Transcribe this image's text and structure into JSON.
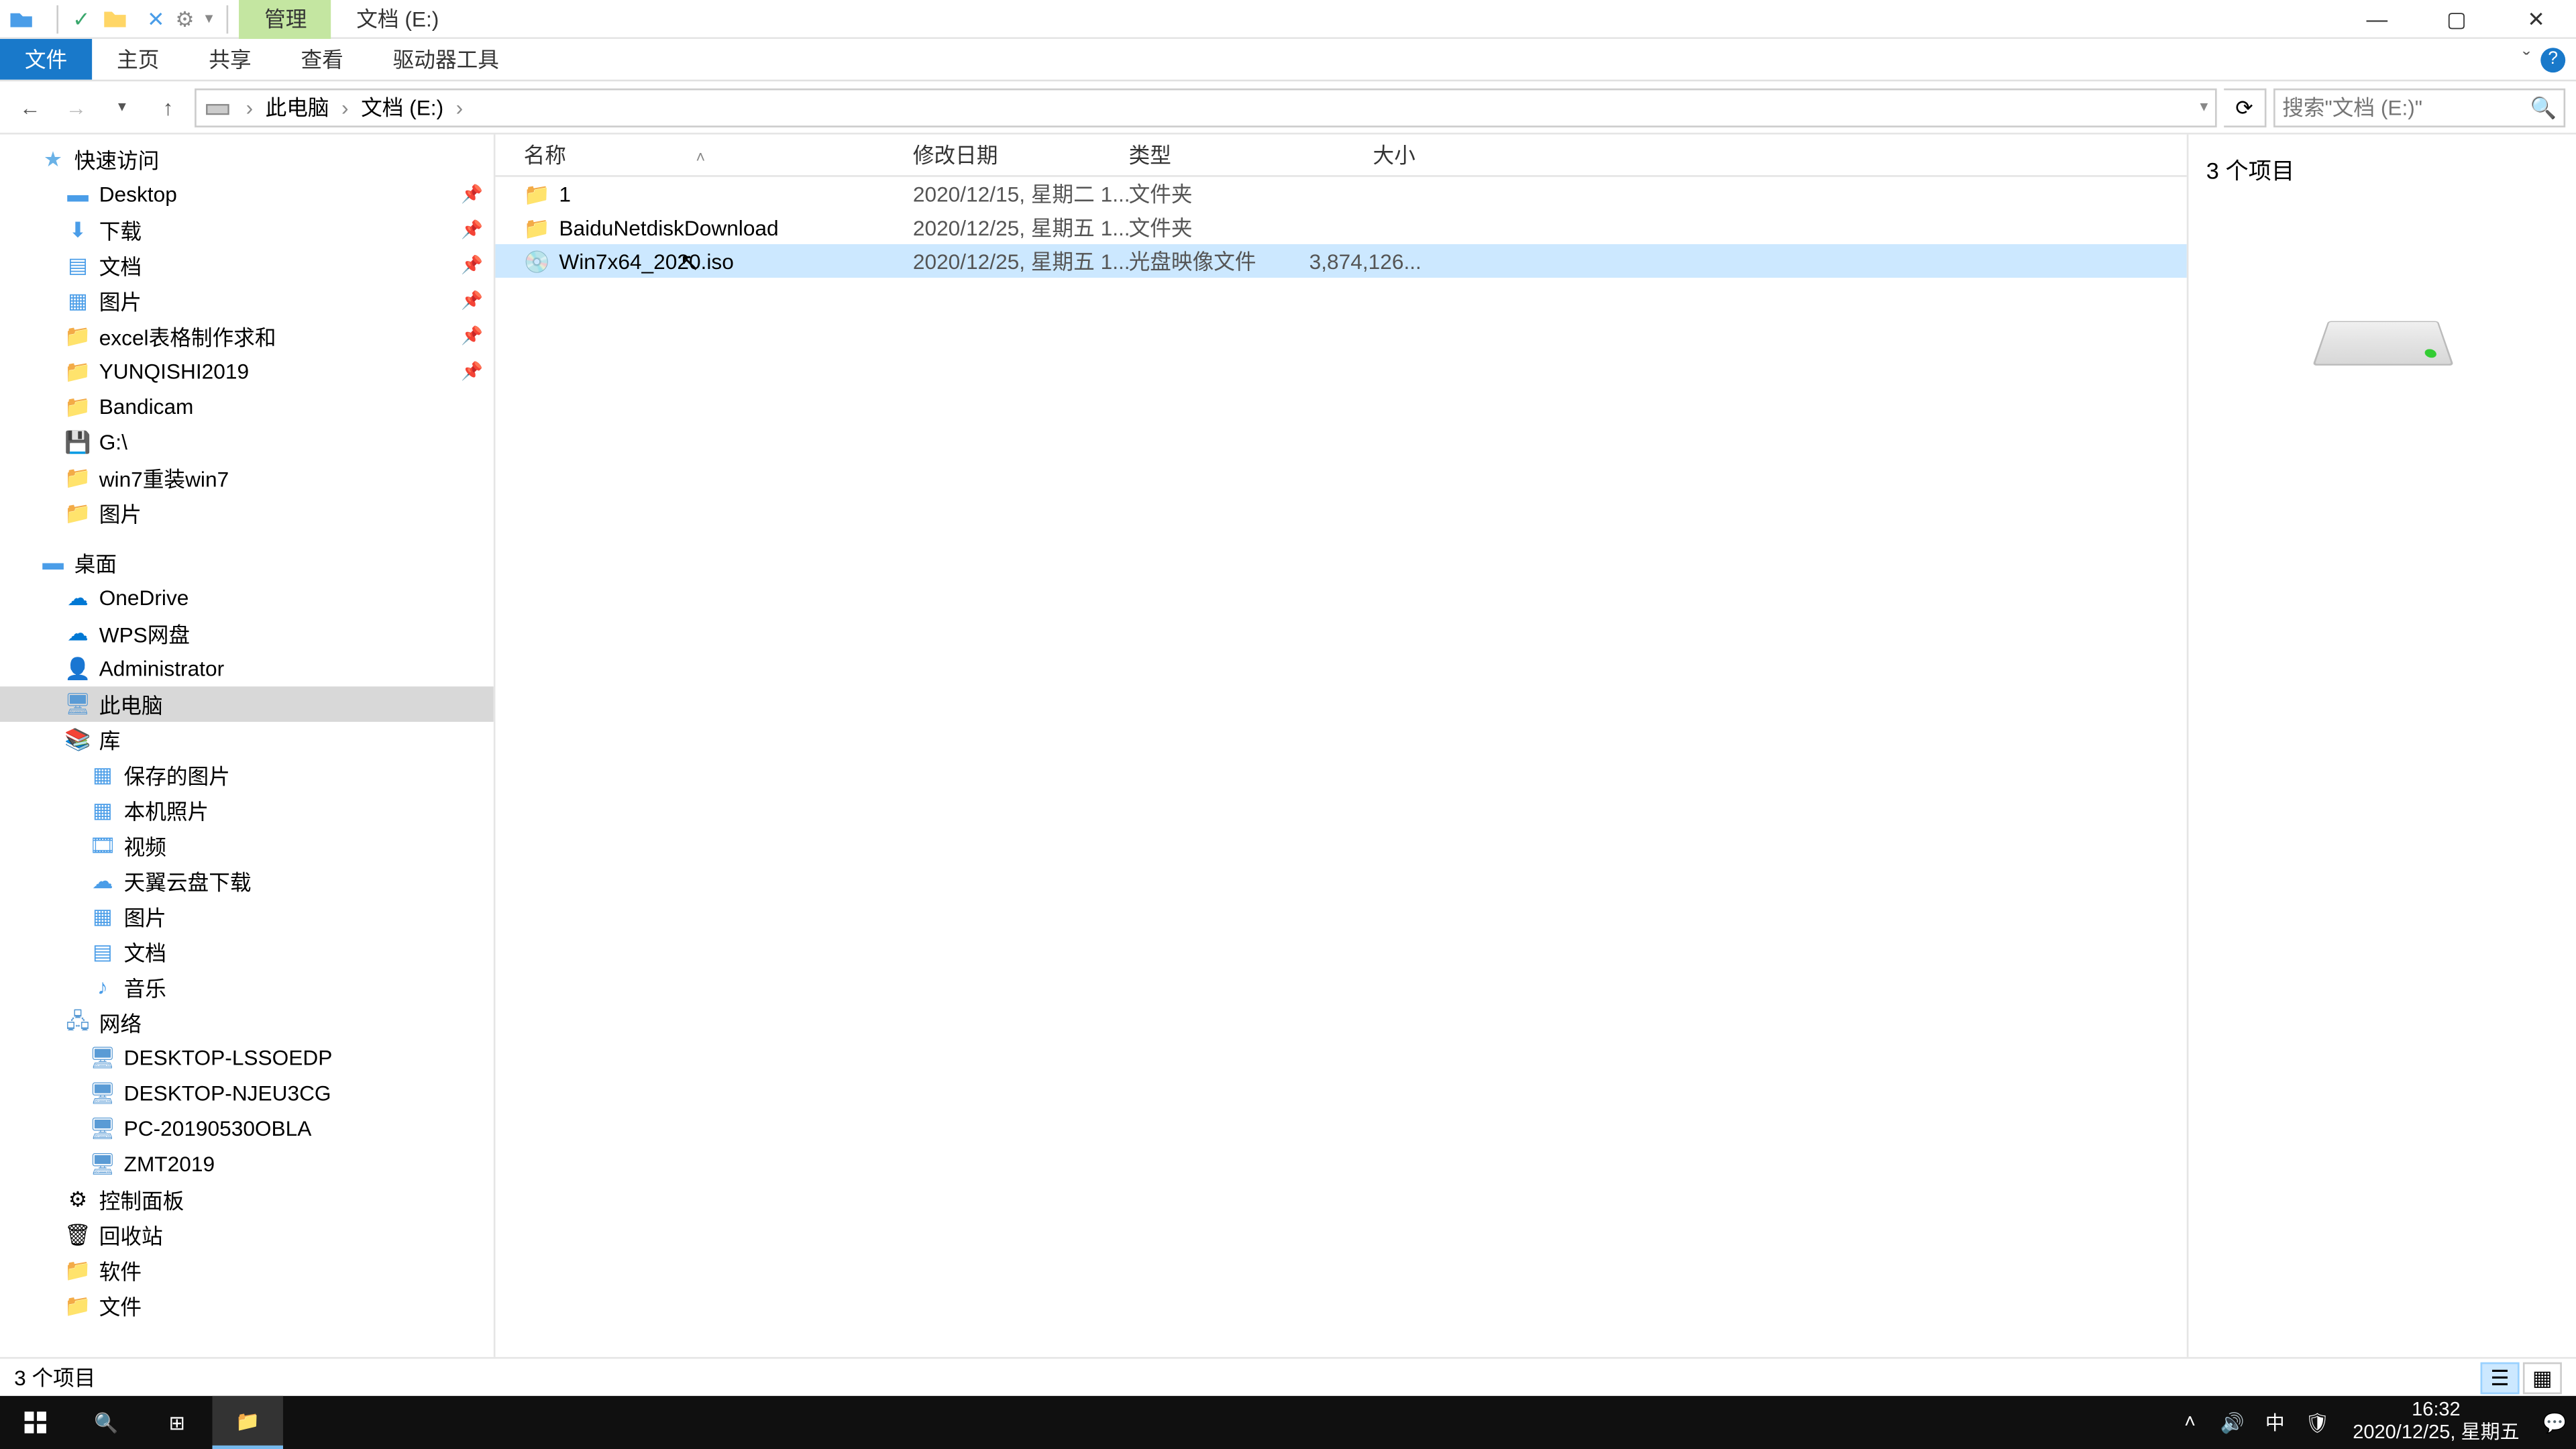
{
  "titlebar": {
    "contextual_tab": "管理",
    "location_tab": "文档 (E:)"
  },
  "ribbon": {
    "file": "文件",
    "home": "主页",
    "share": "共享",
    "view": "查看",
    "drive_tools": "驱动器工具"
  },
  "breadcrumb": {
    "root": "此电脑",
    "drive": "文档 (E:)"
  },
  "search": {
    "placeholder": "搜索\"文档 (E:)\""
  },
  "nav": {
    "quick_access": "快速访问",
    "desktop": "Desktop",
    "downloads": "下载",
    "documents": "文档",
    "pictures": "图片",
    "excel": "excel表格制作求和",
    "yunqishi": "YUNQISHI2019",
    "bandicam": "Bandicam",
    "gdrive": "G:\\",
    "win7reinstall": "win7重装win7",
    "pictures2": "图片",
    "desktop2": "桌面",
    "onedrive": "OneDrive",
    "wps": "WPS网盘",
    "administrator": "Administrator",
    "thispc": "此电脑",
    "libraries": "库",
    "saved_pics": "保存的图片",
    "camera_roll": "本机照片",
    "videos": "视频",
    "tianyi": "天翼云盘下载",
    "lib_pictures": "图片",
    "lib_documents": "文档",
    "lib_music": "音乐",
    "network": "网络",
    "pc1": "DESKTOP-LSSOEDP",
    "pc2": "DESKTOP-NJEU3CG",
    "pc3": "PC-20190530OBLA",
    "pc4": "ZMT2019",
    "control_panel": "控制面板",
    "recycle": "回收站",
    "software": "软件",
    "files": "文件"
  },
  "columns": {
    "name": "名称",
    "date": "修改日期",
    "type": "类型",
    "size": "大小"
  },
  "files": [
    {
      "name": "1",
      "date": "2020/12/15, 星期二 1...",
      "type": "文件夹",
      "size": "",
      "icon": "folder"
    },
    {
      "name": "BaiduNetdiskDownload",
      "date": "2020/12/25, 星期五 1...",
      "type": "文件夹",
      "size": "",
      "icon": "folder"
    },
    {
      "name": "Win7x64_2020.iso",
      "date": "2020/12/25, 星期五 1...",
      "type": "光盘映像文件",
      "size": "3,874,126...",
      "icon": "disc",
      "selected": true
    }
  ],
  "preview": {
    "title": "3 个项目"
  },
  "statusbar": {
    "count": "3 个项目"
  },
  "taskbar": {
    "time": "16:32",
    "date": "2020/12/25, 星期五",
    "ime": "中"
  }
}
